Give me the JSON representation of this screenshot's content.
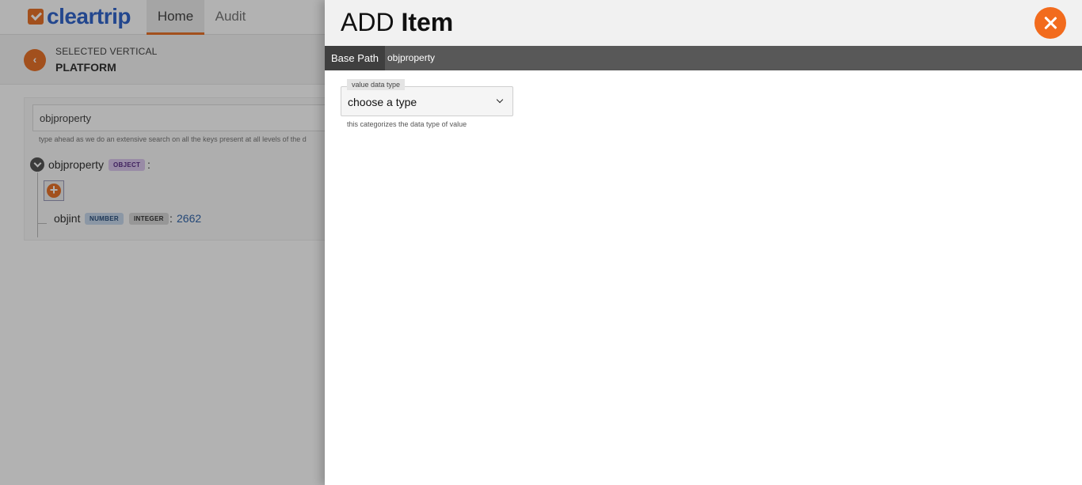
{
  "app": {
    "logo_text": "cleartrip",
    "nav": {
      "home": "Home",
      "audit": "Audit"
    },
    "vertical": {
      "label": "SELECTED VERTICAL",
      "value": "PLATFORM"
    },
    "search": {
      "value": "objproperty",
      "hint": "type ahead as we do an extensive search on all the keys present at all levels of the d"
    },
    "tree": {
      "root": {
        "key": "objproperty",
        "type_badge": "OBJECT",
        "separator": ":"
      },
      "child": {
        "key": "objint",
        "type_badge": "NUMBER",
        "subtype_badge": "INTEGER",
        "separator": ":",
        "value": "2662"
      }
    }
  },
  "drawer": {
    "title_prefix": "ADD",
    "title_main": "Item",
    "base_path": {
      "label": "Base Path",
      "value": "objproperty"
    },
    "value_data_type": {
      "legend": "value data type",
      "selected": "choose a type",
      "help_text": "this categorizes the data type of value"
    }
  },
  "colors": {
    "accent": "#e8732a",
    "close_button": "#f26b1d",
    "brand_blue": "#3366cc",
    "base_path_bar": "#585858"
  }
}
